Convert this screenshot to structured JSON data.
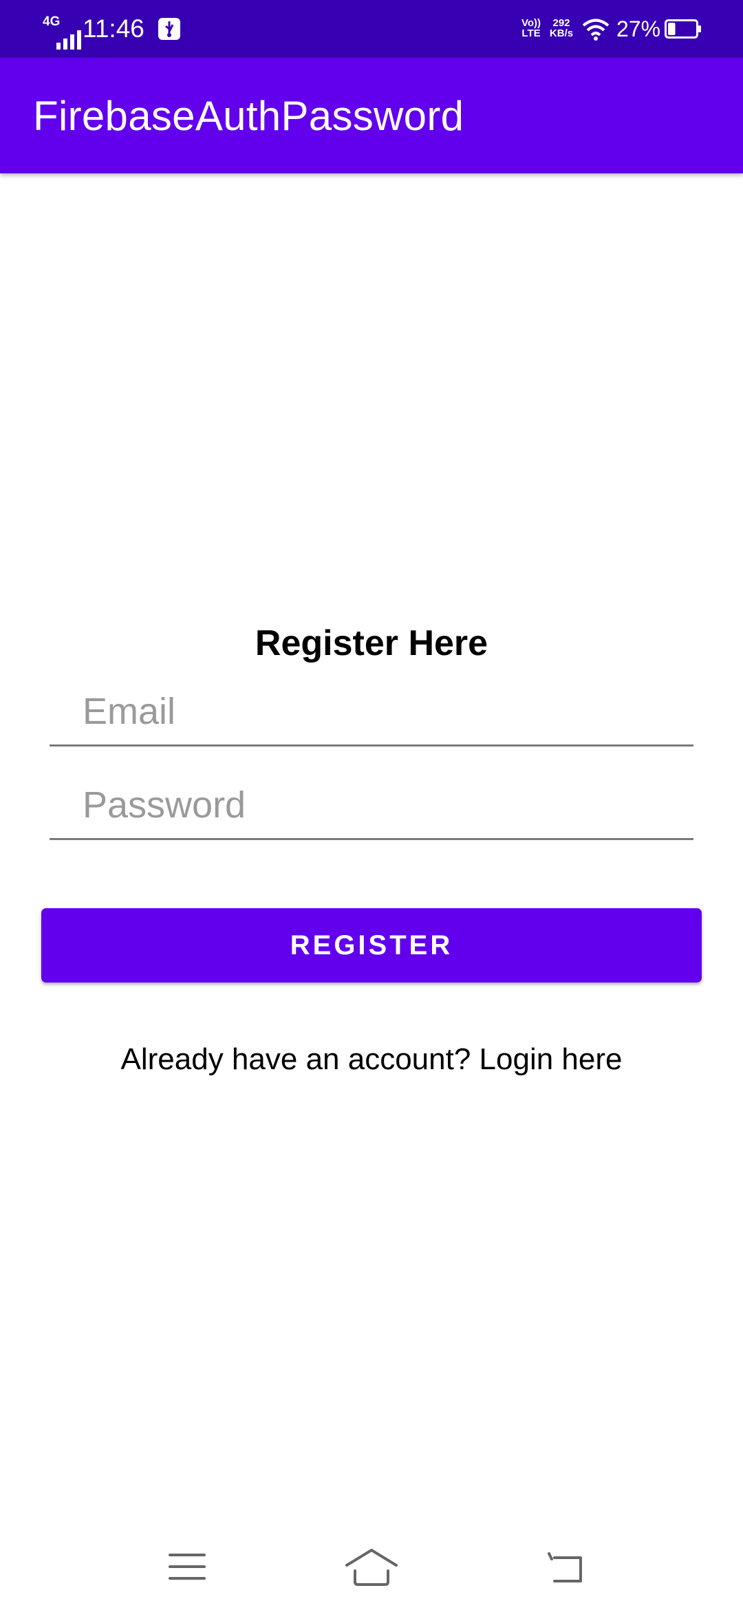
{
  "status_bar": {
    "network_type": "4G",
    "time": "11:46",
    "volte_line1": "Vo))",
    "volte_line2": "LTE",
    "speed_value": "292",
    "speed_unit": "KB/s",
    "battery_percent": "27%",
    "battery_level": 0.27
  },
  "app_bar": {
    "title": "FirebaseAuthPassword"
  },
  "form": {
    "heading": "Register Here",
    "email": {
      "value": "",
      "placeholder": "Email"
    },
    "password": {
      "value": "",
      "placeholder": "Password"
    },
    "register_label": "REGISTER",
    "login_link": "Already have an account? Login here"
  },
  "navigation": {
    "menu_icon": "menu-icon",
    "home_icon": "home-icon",
    "back_icon": "back-icon"
  },
  "colors": {
    "status_bar": "#3700b3",
    "primary": "#6200ee",
    "on_primary": "#ffffff",
    "hint_text": "#9a9a9a",
    "underline": "#7a7a7a"
  }
}
